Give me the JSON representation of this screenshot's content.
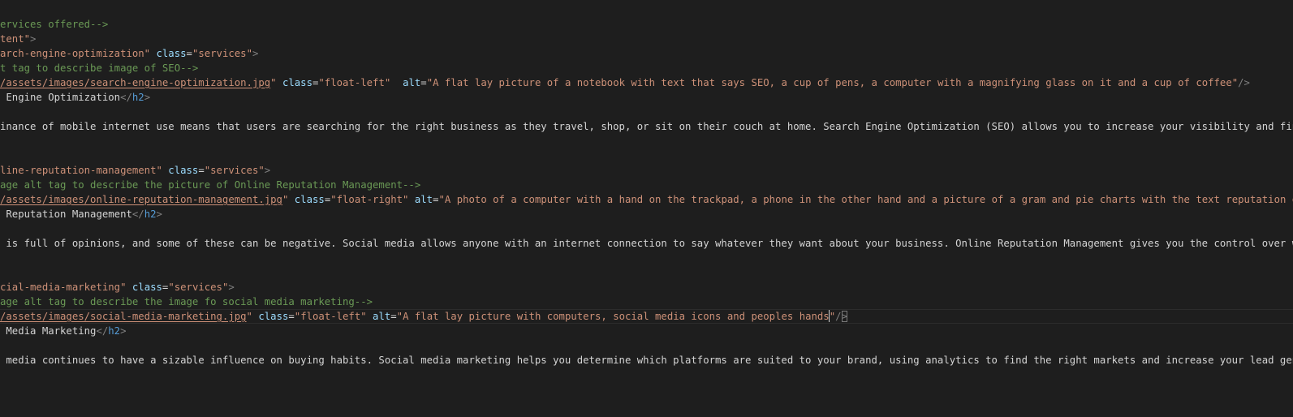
{
  "editor": {
    "lines": [
      [
        {
          "c": "comment",
          "t": "ervices offered-->"
        }
      ],
      [
        {
          "c": "string",
          "t": "tent\""
        },
        {
          "c": "punct",
          "t": ">"
        }
      ],
      [
        {
          "c": "string",
          "t": "arch-engine-optimization\""
        },
        {
          "c": "text",
          "t": " "
        },
        {
          "c": "attr",
          "t": "class"
        },
        {
          "c": "text",
          "t": "="
        },
        {
          "c": "string",
          "t": "\"services\""
        },
        {
          "c": "punct",
          "t": ">"
        }
      ],
      [
        {
          "c": "comment",
          "t": "t tag to describe image of SEO-->"
        }
      ],
      [
        {
          "c": "link",
          "t": "/assets/images/search-engine-optimization.jpg"
        },
        {
          "c": "string",
          "t": "\""
        },
        {
          "c": "text",
          "t": " "
        },
        {
          "c": "attr",
          "t": "class"
        },
        {
          "c": "text",
          "t": "="
        },
        {
          "c": "string",
          "t": "\"float-left\""
        },
        {
          "c": "text",
          "t": "  "
        },
        {
          "c": "attr",
          "t": "alt"
        },
        {
          "c": "text",
          "t": "="
        },
        {
          "c": "string",
          "t": "\"A flat lay picture of a notebook with text that says SEO, a cup of pens, a computer with a magnifying glass on it and a cup of coffee\""
        },
        {
          "c": "punct",
          "t": "/>"
        }
      ],
      [
        {
          "c": "text",
          "t": " Engine Optimization"
        },
        {
          "c": "punct",
          "t": "</"
        },
        {
          "c": "tag",
          "t": "h2"
        },
        {
          "c": "punct",
          "t": ">"
        }
      ],
      [],
      [
        {
          "c": "text",
          "t": "inance of mobile internet use means that users are searching for the right business as they travel, shop, or sit on their couch at home. Search Engine Optimization (SEO) allows you to increase your visibility and find th"
        }
      ],
      [],
      [],
      [
        {
          "c": "string",
          "t": "line-reputation-management\""
        },
        {
          "c": "text",
          "t": " "
        },
        {
          "c": "attr",
          "t": "class"
        },
        {
          "c": "text",
          "t": "="
        },
        {
          "c": "string",
          "t": "\"services\""
        },
        {
          "c": "punct",
          "t": ">"
        }
      ],
      [
        {
          "c": "comment",
          "t": "age alt tag to describe the picture of Online Reputation Management-->"
        }
      ],
      [
        {
          "c": "link",
          "t": "/assets/images/online-reputation-management.jpg"
        },
        {
          "c": "string",
          "t": "\""
        },
        {
          "c": "text",
          "t": " "
        },
        {
          "c": "attr",
          "t": "class"
        },
        {
          "c": "text",
          "t": "="
        },
        {
          "c": "string",
          "t": "\"float-right\""
        },
        {
          "c": "text",
          "t": " "
        },
        {
          "c": "attr",
          "t": "alt"
        },
        {
          "c": "text",
          "t": "="
        },
        {
          "c": "string",
          "t": "\"A photo of a computer with a hand on the trackpad, a phone in the other hand and a picture of a gram and pie charts with the text reputation on th"
        }
      ],
      [
        {
          "c": "text",
          "t": " Reputation Management"
        },
        {
          "c": "punct",
          "t": "</"
        },
        {
          "c": "tag",
          "t": "h2"
        },
        {
          "c": "punct",
          "t": ">"
        }
      ],
      [],
      [
        {
          "c": "text",
          "t": " is full of opinions, and some of these can be negative. Social media allows anyone with an internet connection to say whatever they want about your business. Online Reputation Management gives you the control over what "
        }
      ],
      [],
      [],
      [
        {
          "c": "string",
          "t": "cial-media-marketing\""
        },
        {
          "c": "text",
          "t": " "
        },
        {
          "c": "attr",
          "t": "class"
        },
        {
          "c": "text",
          "t": "="
        },
        {
          "c": "string",
          "t": "\"services\""
        },
        {
          "c": "punct",
          "t": ">"
        }
      ],
      [
        {
          "c": "comment",
          "t": "age alt tag to describe the image fo social media marketing-->"
        }
      ],
      [
        {
          "c": "link",
          "t": "/assets/images/social-media-marketing.jpg"
        },
        {
          "c": "string",
          "t": "\""
        },
        {
          "c": "text",
          "t": " "
        },
        {
          "c": "attr",
          "t": "class"
        },
        {
          "c": "text",
          "t": "="
        },
        {
          "c": "string",
          "t": "\"float-left\""
        },
        {
          "c": "text",
          "t": " "
        },
        {
          "c": "attr",
          "t": "alt"
        },
        {
          "c": "text",
          "t": "="
        },
        {
          "c": "string",
          "t": "\"A flat lay picture with computers, social media icons and peoples hands"
        },
        {
          "c": "cursor",
          "t": ""
        },
        {
          "c": "string",
          "t": "\""
        },
        {
          "c": "punct",
          "t": "/"
        },
        {
          "c": "bracket",
          "t": ">"
        }
      ],
      [
        {
          "c": "text",
          "t": " Media Marketing"
        },
        {
          "c": "punct",
          "t": "</"
        },
        {
          "c": "tag",
          "t": "h2"
        },
        {
          "c": "punct",
          "t": ">"
        }
      ],
      [],
      [
        {
          "c": "text",
          "t": " media continues to have a sizable influence on buying habits. Social media marketing helps you determine which platforms are suited to your brand, using analytics to find the right markets and increase your lead generati"
        }
      ]
    ],
    "current_line": 20,
    "theme": {
      "background": "#1e1e1e",
      "comment": "#6a9955",
      "string": "#ce9178",
      "attribute": "#9cdcfe",
      "tag": "#569cd6",
      "text": "#d4d4d4"
    }
  }
}
